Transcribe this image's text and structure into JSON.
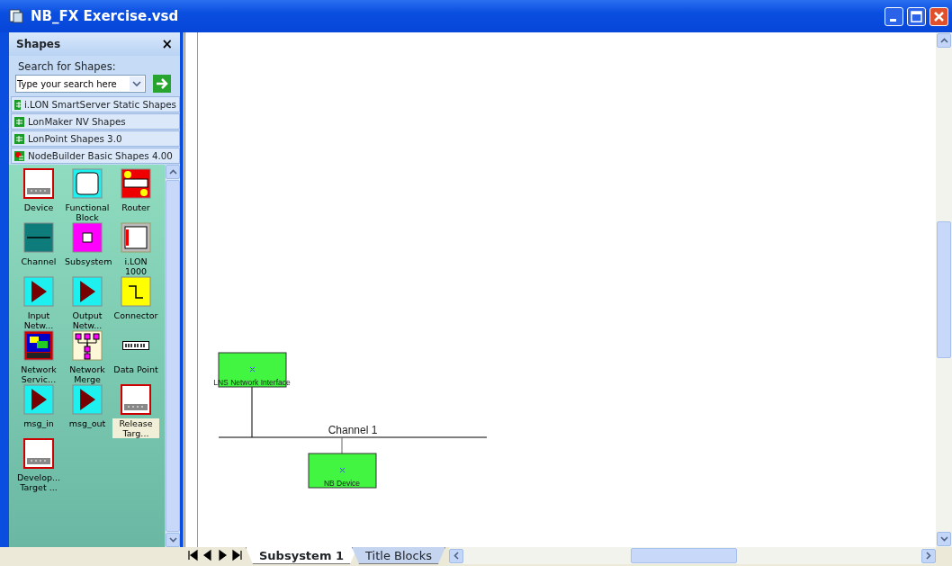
{
  "window": {
    "title": "NB_FX Exercise.vsd"
  },
  "shapes_panel": {
    "title": "Shapes",
    "close": "×",
    "search_label": "Search for Shapes:",
    "search_placeholder": "Type your search here",
    "stencils": [
      {
        "label": "i.LON SmartServer Static Shapes",
        "kind": "grid"
      },
      {
        "label": "LonMaker NV Shapes",
        "kind": "grid"
      },
      {
        "label": "LonPoint Shapes 3.0",
        "kind": "grid"
      },
      {
        "label": "NodeBuilder Basic Shapes 4.00",
        "kind": "spark"
      }
    ],
    "shapes": [
      {
        "label": "Device",
        "kind": "device",
        "selected": false
      },
      {
        "label": "Functional Block",
        "kind": "block",
        "selected": false
      },
      {
        "label": "Router",
        "kind": "router",
        "selected": false
      },
      {
        "label": "Channel",
        "kind": "channel",
        "selected": false
      },
      {
        "label": "Subsystem",
        "kind": "subsystem",
        "selected": false
      },
      {
        "label": "i.LON 1000",
        "kind": "ilon",
        "selected": false
      },
      {
        "label": "Input Netw...",
        "kind": "triangle",
        "selected": false
      },
      {
        "label": "Output Netw...",
        "kind": "triangle",
        "selected": false
      },
      {
        "label": "Connector",
        "kind": "connector",
        "selected": false
      },
      {
        "label": "Network Servic...",
        "kind": "service",
        "selected": false
      },
      {
        "label": "Network Merge",
        "kind": "merge",
        "selected": false
      },
      {
        "label": "Data Point",
        "kind": "datapoint",
        "selected": false
      },
      {
        "label": "msg_in",
        "kind": "triangle",
        "selected": false
      },
      {
        "label": "msg_out",
        "kind": "triangle",
        "selected": false
      },
      {
        "label": "Release Targ...",
        "kind": "device",
        "selected": true
      },
      {
        "label": "Develop... Target ...",
        "kind": "device",
        "selected": false
      }
    ]
  },
  "diagram": {
    "nodes": [
      {
        "label": "LNS Network Interface"
      },
      {
        "label": "NB Device"
      }
    ],
    "channel": {
      "label": "Channel 1"
    }
  },
  "sheet_tabs": [
    {
      "label": "Subsystem 1",
      "selected": true
    },
    {
      "label": "Title Blocks",
      "selected": false
    }
  ]
}
